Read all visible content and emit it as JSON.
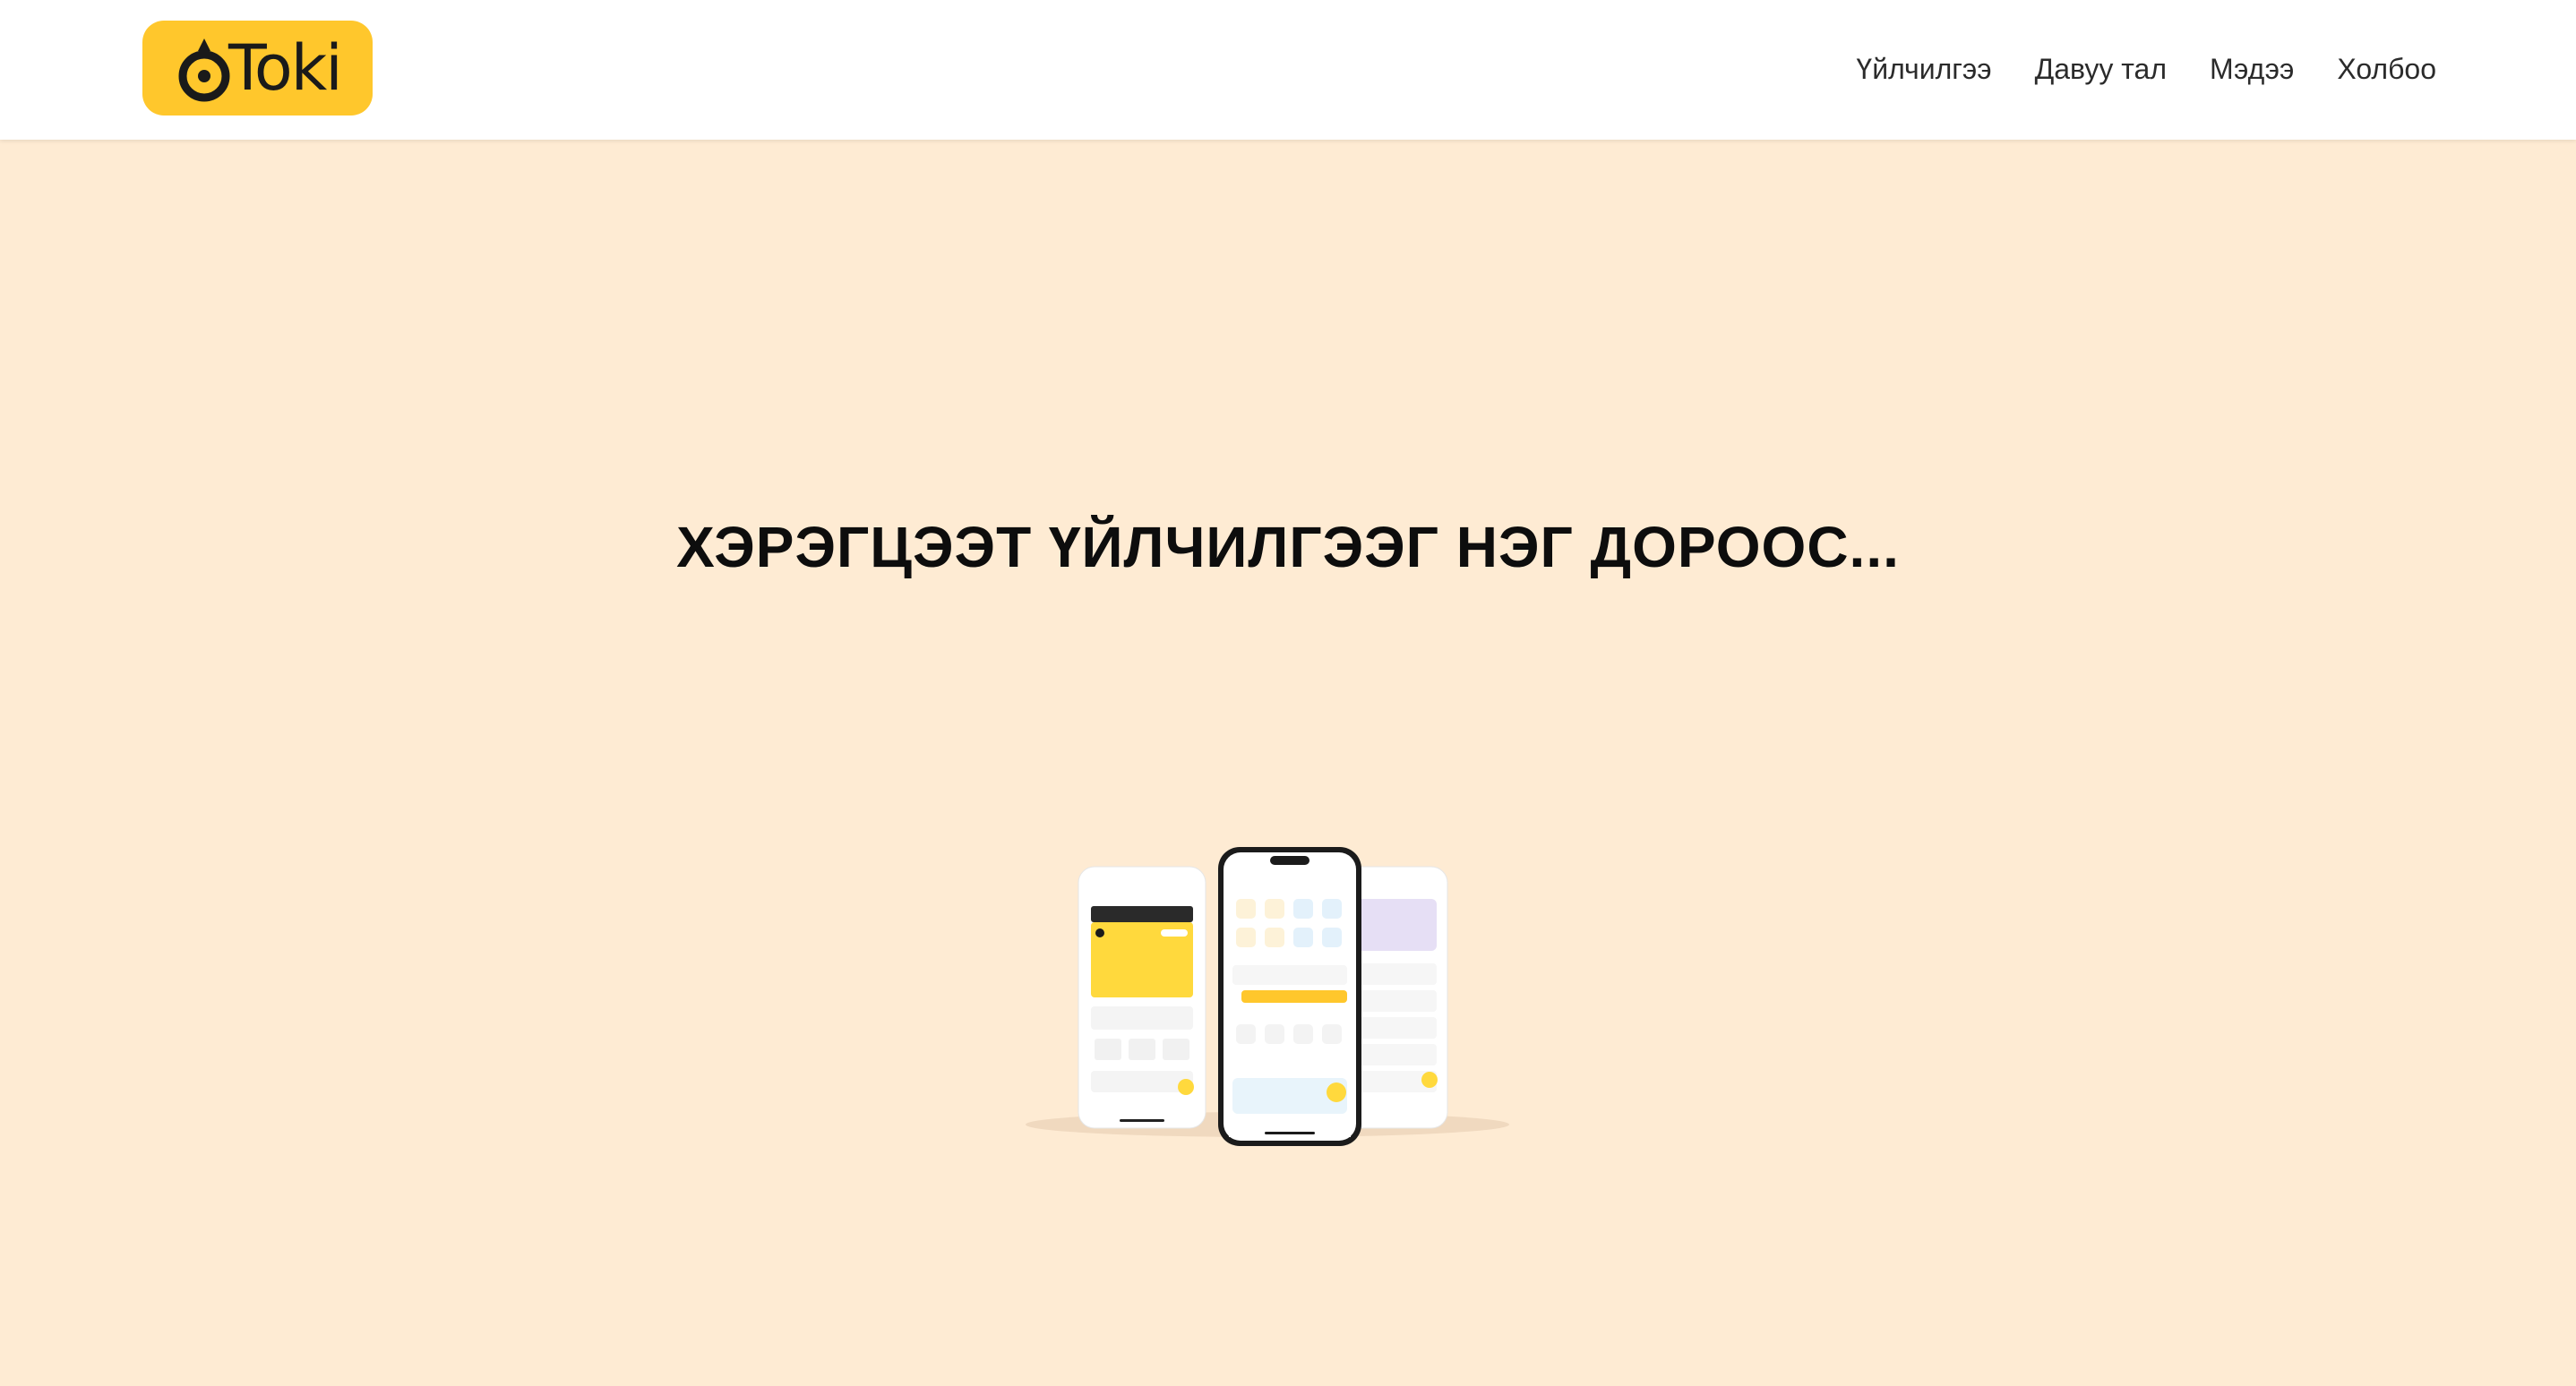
{
  "brand": {
    "name": "Toki",
    "color": "#FFC72C"
  },
  "nav": {
    "items": [
      {
        "label": "Үйлчилгээ"
      },
      {
        "label": "Давуу тал"
      },
      {
        "label": "Мэдээ"
      },
      {
        "label": "Холбоо"
      }
    ]
  },
  "hero": {
    "title": "ХЭРЭГЦЭЭТ ҮЙЛЧИЛГЭЭГ НЭГ ДОРООС...",
    "background": "#FEEBD3",
    "image": "three-phones-app-mockup"
  },
  "colors": {
    "accent": "#FFC72C",
    "text": "#0d0d0d"
  }
}
